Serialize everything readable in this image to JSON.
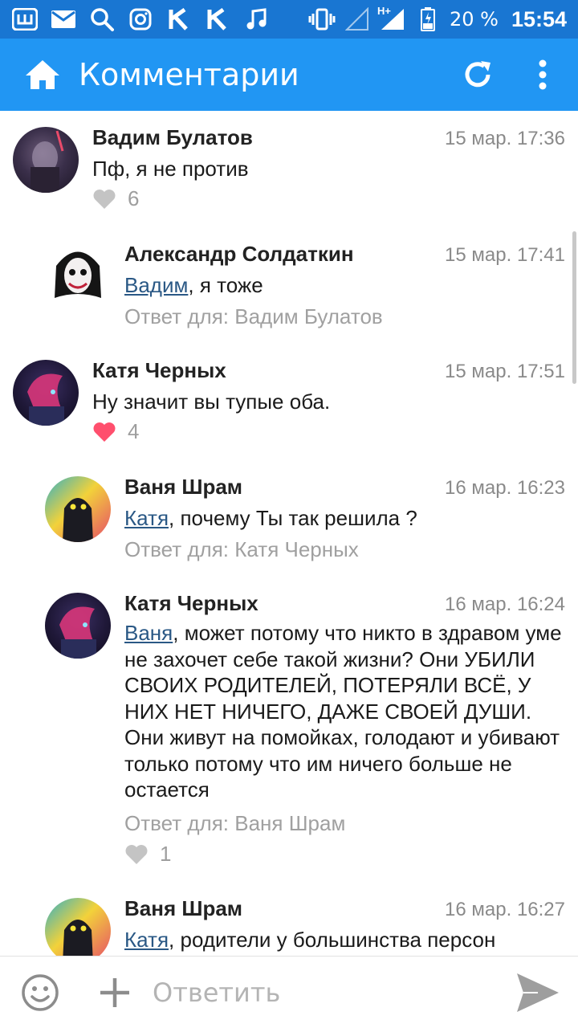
{
  "status_bar": {
    "left_icons": [
      "sheets-icon",
      "mail-icon",
      "search-icon",
      "instagram-icon",
      "k-app-icon",
      "k-app-icon",
      "music-icon"
    ],
    "vibrate_icon": "vibrate-icon",
    "signal_icon": "signal-icon",
    "network_label": "H+",
    "battery_percent": "20 %",
    "time": "15:54"
  },
  "app_bar": {
    "title": "Комментарии",
    "home_icon": "home-icon",
    "refresh_icon": "refresh-icon",
    "menu_icon": "more-vert-icon"
  },
  "comments": [
    {
      "author": "Вадим Булатов",
      "time": "15 мар. 17:36",
      "mention": "",
      "text": "Пф, я не против",
      "reply_to": "",
      "likes": "6",
      "liked": false
    },
    {
      "author": "Александр Солдаткин",
      "time": "15 мар. 17:41",
      "mention": "Вадим",
      "text": ", я тоже",
      "reply_to": "Ответ для: Вадим Булатов",
      "likes": "",
      "liked": false
    },
    {
      "author": "Катя Черных",
      "time": "15 мар. 17:51",
      "mention": "",
      "text": "Ну значит вы тупые оба.",
      "reply_to": "",
      "likes": "4",
      "liked": true
    },
    {
      "author": "Ваня Шрам",
      "time": "16 мар. 16:23",
      "mention": "Катя",
      "text": ", почему Ты так решила ?",
      "reply_to": "Ответ для: Катя Черных",
      "likes": "",
      "liked": false
    },
    {
      "author": "Катя Черных",
      "time": "16 мар. 16:24",
      "mention": "Ваня",
      "text": ", может потому что никто в здравом уме не захочет себе такой жизни? Они УБИЛИ СВОИХ РОДИТЕЛЕЙ, ПОТЕРЯЛИ ВСЁ, У НИХ НЕТ НИЧЕГО, ДАЖЕ СВОЕЙ ДУШИ. Они живут на помойках, голодают и убивают только потому что им ничего больше не остается",
      "reply_to": "Ответ для: Ваня Шрам",
      "likes": "1",
      "liked": false
    },
    {
      "author": "Ваня Шрам",
      "time": "16 мар. 16:27",
      "mention": "Катя",
      "text": ", родители у большинства персон",
      "reply_to": "",
      "likes": "",
      "liked": false
    }
  ],
  "bottom_bar": {
    "placeholder": "Ответить",
    "emoji_icon": "emoji-icon",
    "attach_icon": "plus-icon",
    "send_icon": "send-icon"
  },
  "colors": {
    "status_bar": "#1976d2",
    "app_bar": "#2196f3",
    "mention": "#2a5885",
    "like_active": "#ff4f6d",
    "like_inactive": "#c4c4c4"
  }
}
